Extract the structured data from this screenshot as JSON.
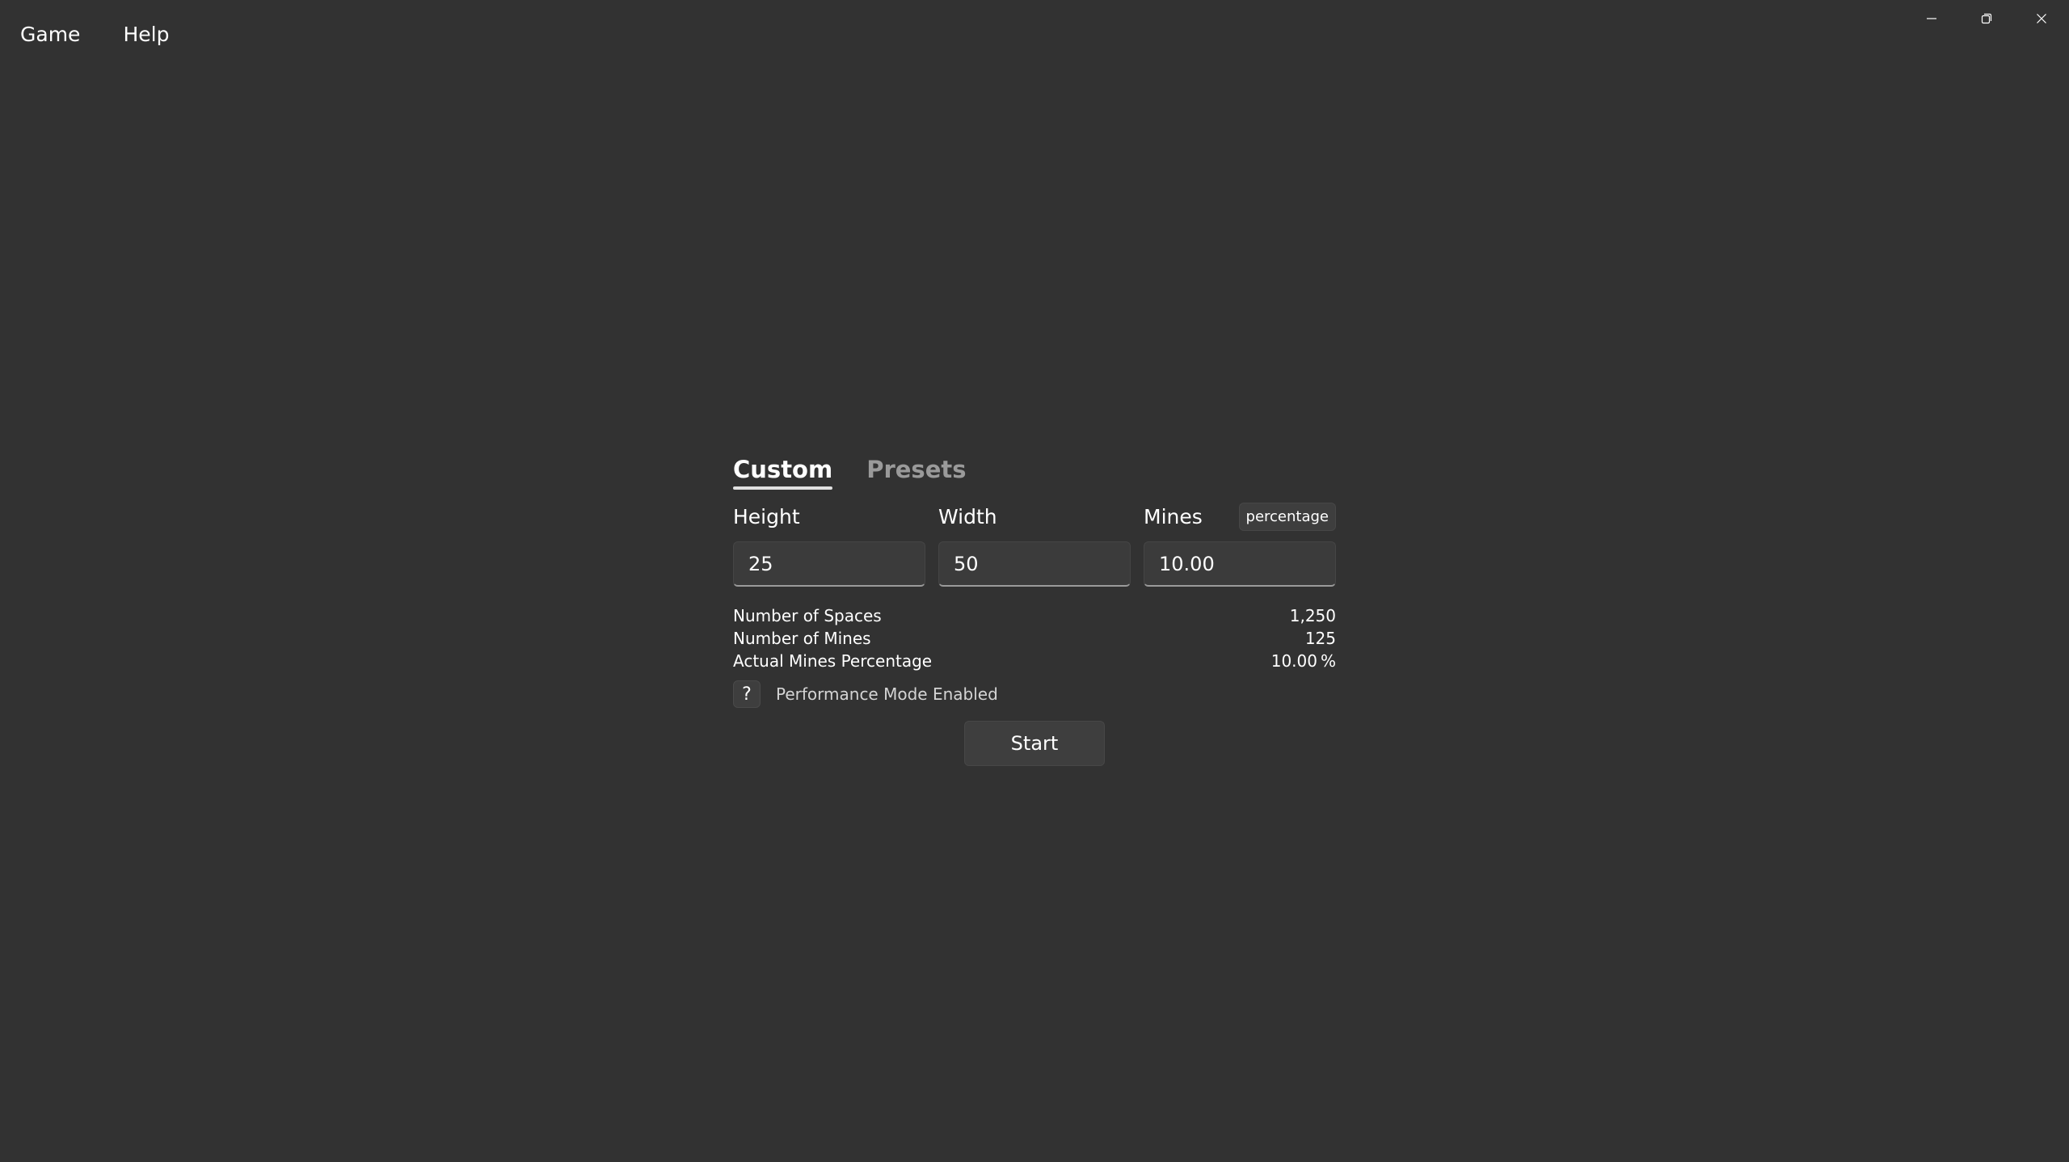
{
  "menubar": {
    "items": [
      {
        "label": "Game"
      },
      {
        "label": "Help"
      }
    ]
  },
  "window_controls": {
    "minimize_icon": "minimize-icon",
    "restore_icon": "restore-icon",
    "close_icon": "close-icon"
  },
  "tabs": [
    {
      "label": "Custom",
      "active": true
    },
    {
      "label": "Presets",
      "active": false
    }
  ],
  "fields": {
    "height": {
      "label": "Height",
      "value": "25"
    },
    "width": {
      "label": "Width",
      "value": "50"
    },
    "mines": {
      "label": "Mines",
      "value": "10.00",
      "mode_label": "percentage"
    }
  },
  "stats": [
    {
      "label": "Number of Spaces",
      "value": "1,250"
    },
    {
      "label": "Number of Mines",
      "value": "125"
    },
    {
      "label": "Actual Mines Percentage",
      "value": "10.00 %"
    }
  ],
  "performance": {
    "help_label": "?",
    "text": "Performance Mode Enabled"
  },
  "start_label": "Start",
  "colors": {
    "background": "#323232",
    "input_background": "#3b3b3b",
    "button_background": "#3e3e3e",
    "inactive_tab": "#9a9a9a",
    "text": "#ffffff"
  }
}
